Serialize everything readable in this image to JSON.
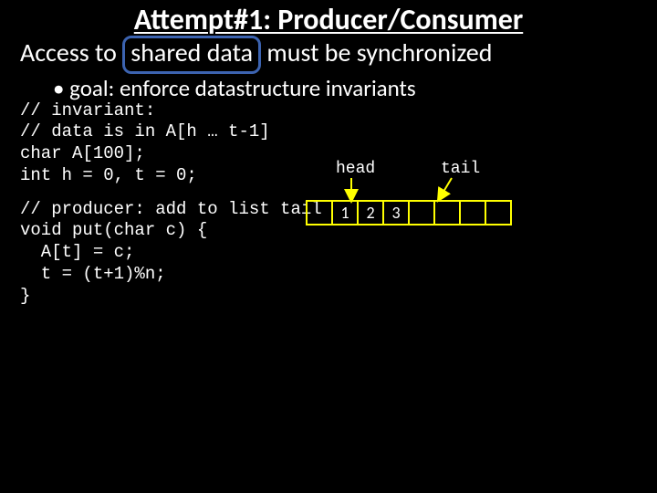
{
  "title": "Attempt#1: Producer/Consumer",
  "subtitle_pre": "Access to",
  "subtitle_box": "shared data",
  "subtitle_post": "must be synchronized",
  "bullet": "goal: enforce datastructure invariants",
  "code_block1": "// invariant:\n// data is in A[h … t-1]\nchar A[100];\nint h = 0, t = 0;",
  "code_block2": "// producer: add to list tail\nvoid put(char c) {\n  A[t] = c;\n  t = (t+1)%n;\n}",
  "diagram": {
    "head_label": "head",
    "tail_label": "tail",
    "cells": [
      "",
      "1",
      "2",
      "3",
      "",
      "",
      "",
      ""
    ]
  }
}
